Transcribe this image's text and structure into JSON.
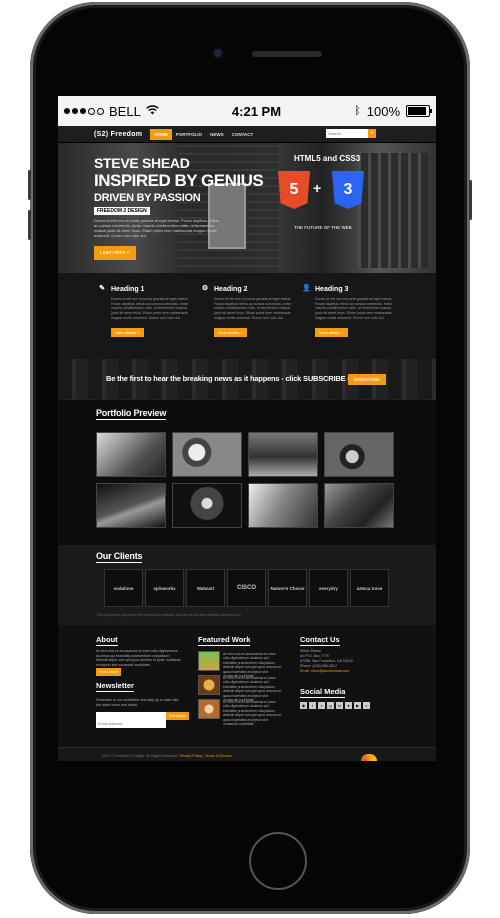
{
  "statusbar": {
    "carrier": "BELL",
    "time": "4:21 PM",
    "battery": "100%",
    "battery_level": 1.0,
    "icons": [
      "signal-dots-icon",
      "wifi-icon",
      "bluetooth-icon",
      "battery-icon"
    ]
  },
  "nav": {
    "logo": "(S2) Freedom",
    "items": [
      {
        "label": "Home",
        "active": true
      },
      {
        "label": "Portfolio",
        "active": false
      },
      {
        "label": "News",
        "active": false
      },
      {
        "label": "Contact",
        "active": false
      }
    ],
    "search_placeholder": "Search",
    "search_icon": "search-icon"
  },
  "hero": {
    "line1": "STEVE SHEAD",
    "line2": "INSPIRED BY GENIUS",
    "line3": "DRIVEN BY PASSION",
    "tag": "FREEDOM 2 DESIGN",
    "text": "Donec id elit non mi porta gravida at eget metus. Fusce dapibus, tellus ac cursus commodo, tortor mauris condimentum nibh, ut fermentum massa justo sit amet risus. Etiam porta sem malesuada magna mollis euismod. Donec sed odio dui.",
    "button": "Learn more »",
    "tech_title": "HTML5 and CSS3",
    "html5_label": "5",
    "css3_label": "3",
    "plus": "+",
    "future": "THE FUTURE OF THE WEB"
  },
  "features": [
    {
      "icon": "pencil-icon",
      "glyph": "✎",
      "title": "Heading 1",
      "text": "Donec id elit non mi porta gravida at eget metus. Fusce dapibus, tellus ac cursus commodo, tortor mauris condimentum nibh, ut fermentum massa justo sit amet risus. Etiam porta sem malesuada magna mollis euismod. Donec sed odio dui.",
      "button": "View details »"
    },
    {
      "icon": "gear-icon",
      "glyph": "⚙",
      "title": "Heading 2",
      "text": "Donec id elit non mi porta gravida at eget metus. Fusce dapibus, tellus ac cursus commodo, tortor mauris condimentum nibh, ut fermentum massa justo sit amet risus. Etiam porta sem malesuada magna mollis euismod. Donec sed odio dui.",
      "button": "View details »"
    },
    {
      "icon": "user-icon",
      "glyph": "👤",
      "title": "Heading 3",
      "text": "Donec id elit non mi porta gravida at eget metus. Fusce dapibus, tellus ac cursus commodo, tortor mauris condimentum nibh, ut fermentum massa justo sit amet risus. Etiam porta sem malesuada magna mollis euismod. Donec sed odio dui.",
      "button": "View details »"
    }
  ],
  "subscribe": {
    "text": "Be the first to hear the breaking news as it happens - click SUBSCRIBE now!",
    "button": "SUBSCRIBE"
  },
  "portfolio": {
    "title": "Portfolio Preview",
    "thumbs": [
      "photo-hands-icon",
      "photo-reel-icon",
      "photo-desk-icon",
      "photo-camera-icon",
      "photo-tower-icon",
      "photo-robot-icon",
      "photo-chart-icon",
      "photo-telescope-icon"
    ]
  },
  "clients": {
    "title": "Our Clients",
    "logos": [
      "vodafone",
      "spinworkx",
      "Walmart",
      "CISCO",
      "Nature's Choice",
      "everydry",
      "azteca trece"
    ],
    "note": "* All logos are the property of the respective companies, and are used for demonstration purposes only."
  },
  "footer": {
    "about_title": "About",
    "about_text": "At vero eos et accusamus et iusto odio dignissimos ducimus qui blanditiis praesentium voluptatum deleniti atque corrupti quos dolores et quas molestias excepturi sint occaecati cupiditate.",
    "read_more": "Read More",
    "newsletter_title": "Newsletter",
    "newsletter_text": "Subscribe to our newsletter and stay up to date with the latest news and deals!",
    "email_placeholder": "Email Address",
    "newsletter_button": "Subscribe",
    "featured_title": "Featured Work",
    "featured": [
      {
        "text": "At vero eos et accusamus et iusto odio dignissimos ducimus qui blanditiis praesentium voluptatum deleniti atque corrupti quos dolores et quas molestias excepturi sint occaecati cupiditate."
      },
      {
        "text": "At vero eos et accusamus et iusto odio dignissimos ducimus qui blanditiis praesentium voluptatum deleniti atque corrupti quos dolores et quas molestias excepturi sint occaecati cupiditate."
      },
      {
        "text": "At vero eos et accusamus et iusto odio dignissimos ducimus qui blanditiis praesentium voluptatum deleniti atque corrupti quos dolores et quas molestias excepturi sint occaecati cupiditate."
      }
    ],
    "contact_title": "Contact Us",
    "contact_lines": [
      "Steve Shead",
      "c/o P.O. Box 7775",
      "#7096, San Francisco, CA 94120",
      "Phone: (408) 556-0617",
      "Email: steve@steveshead.com"
    ],
    "social_title": "Social Media",
    "social": [
      "rss-icon",
      "facebook-icon",
      "twitter-icon",
      "google-plus-icon",
      "linkedin-icon",
      "flickr-icon",
      "youtube-icon",
      "vimeo-icon"
    ]
  },
  "bottom": {
    "copyright": "2014 © Freedom 2 Design. All Rights Reserved.",
    "privacy": "Privacy Policy",
    "sep": "|",
    "terms": "Terms of Service"
  },
  "colors": {
    "accent": "#f39c12",
    "background": "#111111"
  }
}
